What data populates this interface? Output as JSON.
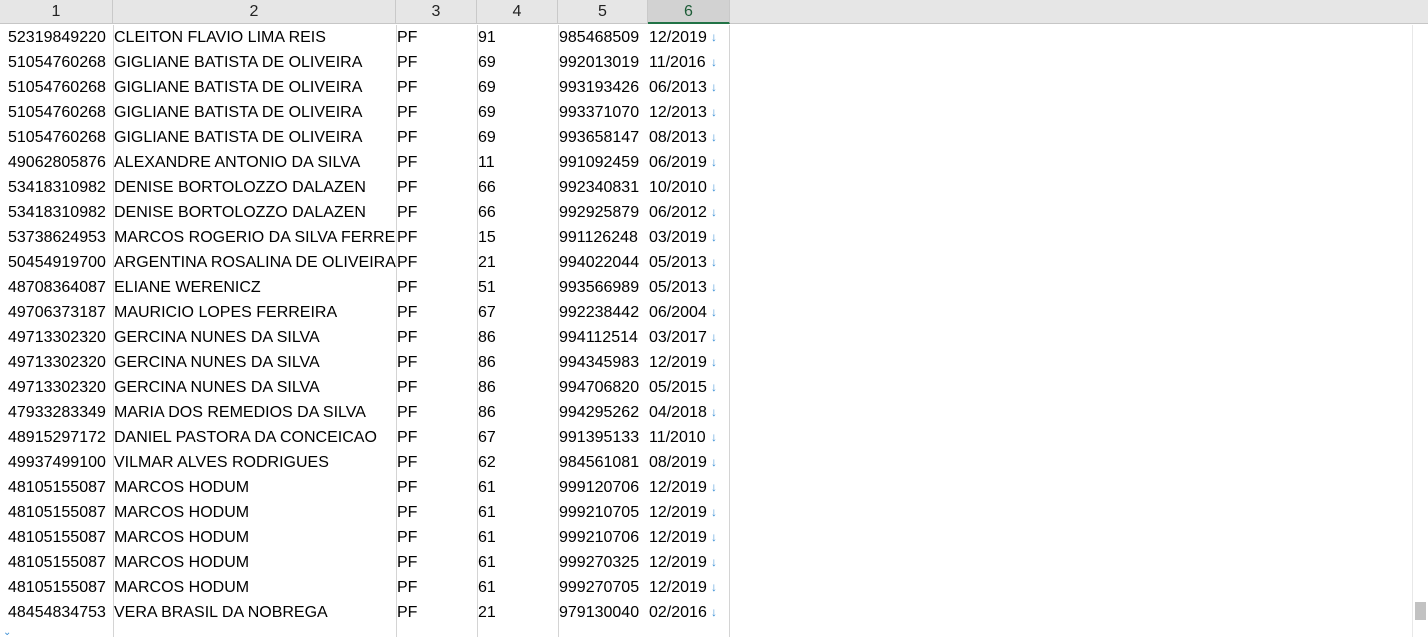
{
  "columns": [
    "1",
    "2",
    "3",
    "4",
    "5",
    "6"
  ],
  "rows": [
    [
      "52319849220",
      "CLEITON FLAVIO LIMA REIS",
      "PF",
      "91",
      "985468509",
      "12/2019"
    ],
    [
      "51054760268",
      "GIGLIANE BATISTA DE OLIVEIRA",
      "PF",
      "69",
      "992013019",
      "11/2016"
    ],
    [
      "51054760268",
      "GIGLIANE BATISTA DE OLIVEIRA",
      "PF",
      "69",
      "993193426",
      "06/2013"
    ],
    [
      "51054760268",
      "GIGLIANE BATISTA DE OLIVEIRA",
      "PF",
      "69",
      "993371070",
      "12/2013"
    ],
    [
      "51054760268",
      "GIGLIANE BATISTA DE OLIVEIRA",
      "PF",
      "69",
      "993658147",
      "08/2013"
    ],
    [
      "49062805876",
      "ALEXANDRE ANTONIO DA SILVA",
      "PF",
      "11",
      "991092459",
      "06/2019"
    ],
    [
      "53418310982",
      "DENISE BORTOLOZZO DALAZEN",
      "PF",
      "66",
      "992340831",
      "10/2010"
    ],
    [
      "53418310982",
      "DENISE BORTOLOZZO DALAZEN",
      "PF",
      "66",
      "992925879",
      "06/2012"
    ],
    [
      "53738624953",
      "MARCOS ROGERIO DA SILVA FERREI",
      "PF",
      "15",
      "991126248",
      "03/2019"
    ],
    [
      "50454919700",
      "ARGENTINA ROSALINA DE OLIVEIRA",
      "PF",
      "21",
      "994022044",
      "05/2013"
    ],
    [
      "48708364087",
      "ELIANE WERENICZ",
      "PF",
      "51",
      "993566989",
      "05/2013"
    ],
    [
      "49706373187",
      "MAURICIO LOPES FERREIRA",
      "PF",
      "67",
      "992238442",
      "06/2004"
    ],
    [
      "49713302320",
      "GERCINA NUNES DA SILVA",
      "PF",
      "86",
      "994112514",
      "03/2017"
    ],
    [
      "49713302320",
      "GERCINA NUNES DA SILVA",
      "PF",
      "86",
      "994345983",
      "12/2019"
    ],
    [
      "49713302320",
      "GERCINA NUNES DA SILVA",
      "PF",
      "86",
      "994706820",
      "05/2015"
    ],
    [
      "47933283349",
      "MARIA DOS REMEDIOS DA SILVA",
      "PF",
      "86",
      "994295262",
      "04/2018"
    ],
    [
      "48915297172",
      "DANIEL PASTORA DA CONCEICAO",
      "PF",
      "67",
      "991395133",
      "11/2010"
    ],
    [
      "49937499100",
      "VILMAR ALVES RODRIGUES",
      "PF",
      "62",
      "984561081",
      "08/2019"
    ],
    [
      "48105155087",
      "MARCOS HODUM",
      "PF",
      "61",
      "999120706",
      "12/2019"
    ],
    [
      "48105155087",
      "MARCOS HODUM",
      "PF",
      "61",
      "999210705",
      "12/2019"
    ],
    [
      "48105155087",
      "MARCOS HODUM",
      "PF",
      "61",
      "999210706",
      "12/2019"
    ],
    [
      "48105155087",
      "MARCOS HODUM",
      "PF",
      "61",
      "999270325",
      "12/2019"
    ],
    [
      "48105155087",
      "MARCOS HODUM",
      "PF",
      "61",
      "999270705",
      "12/2019"
    ],
    [
      "48454834753",
      "VERA BRASIL DA NOBREGA",
      "PF",
      "21",
      "979130040",
      "02/2016"
    ]
  ],
  "selected_column": "6",
  "colors": {
    "header_bg": "#e6e6e6",
    "selected_accent": "#217346",
    "arrow": "#3a8fd6"
  },
  "icons": {
    "cell_marker": "down-arrow-icon"
  }
}
